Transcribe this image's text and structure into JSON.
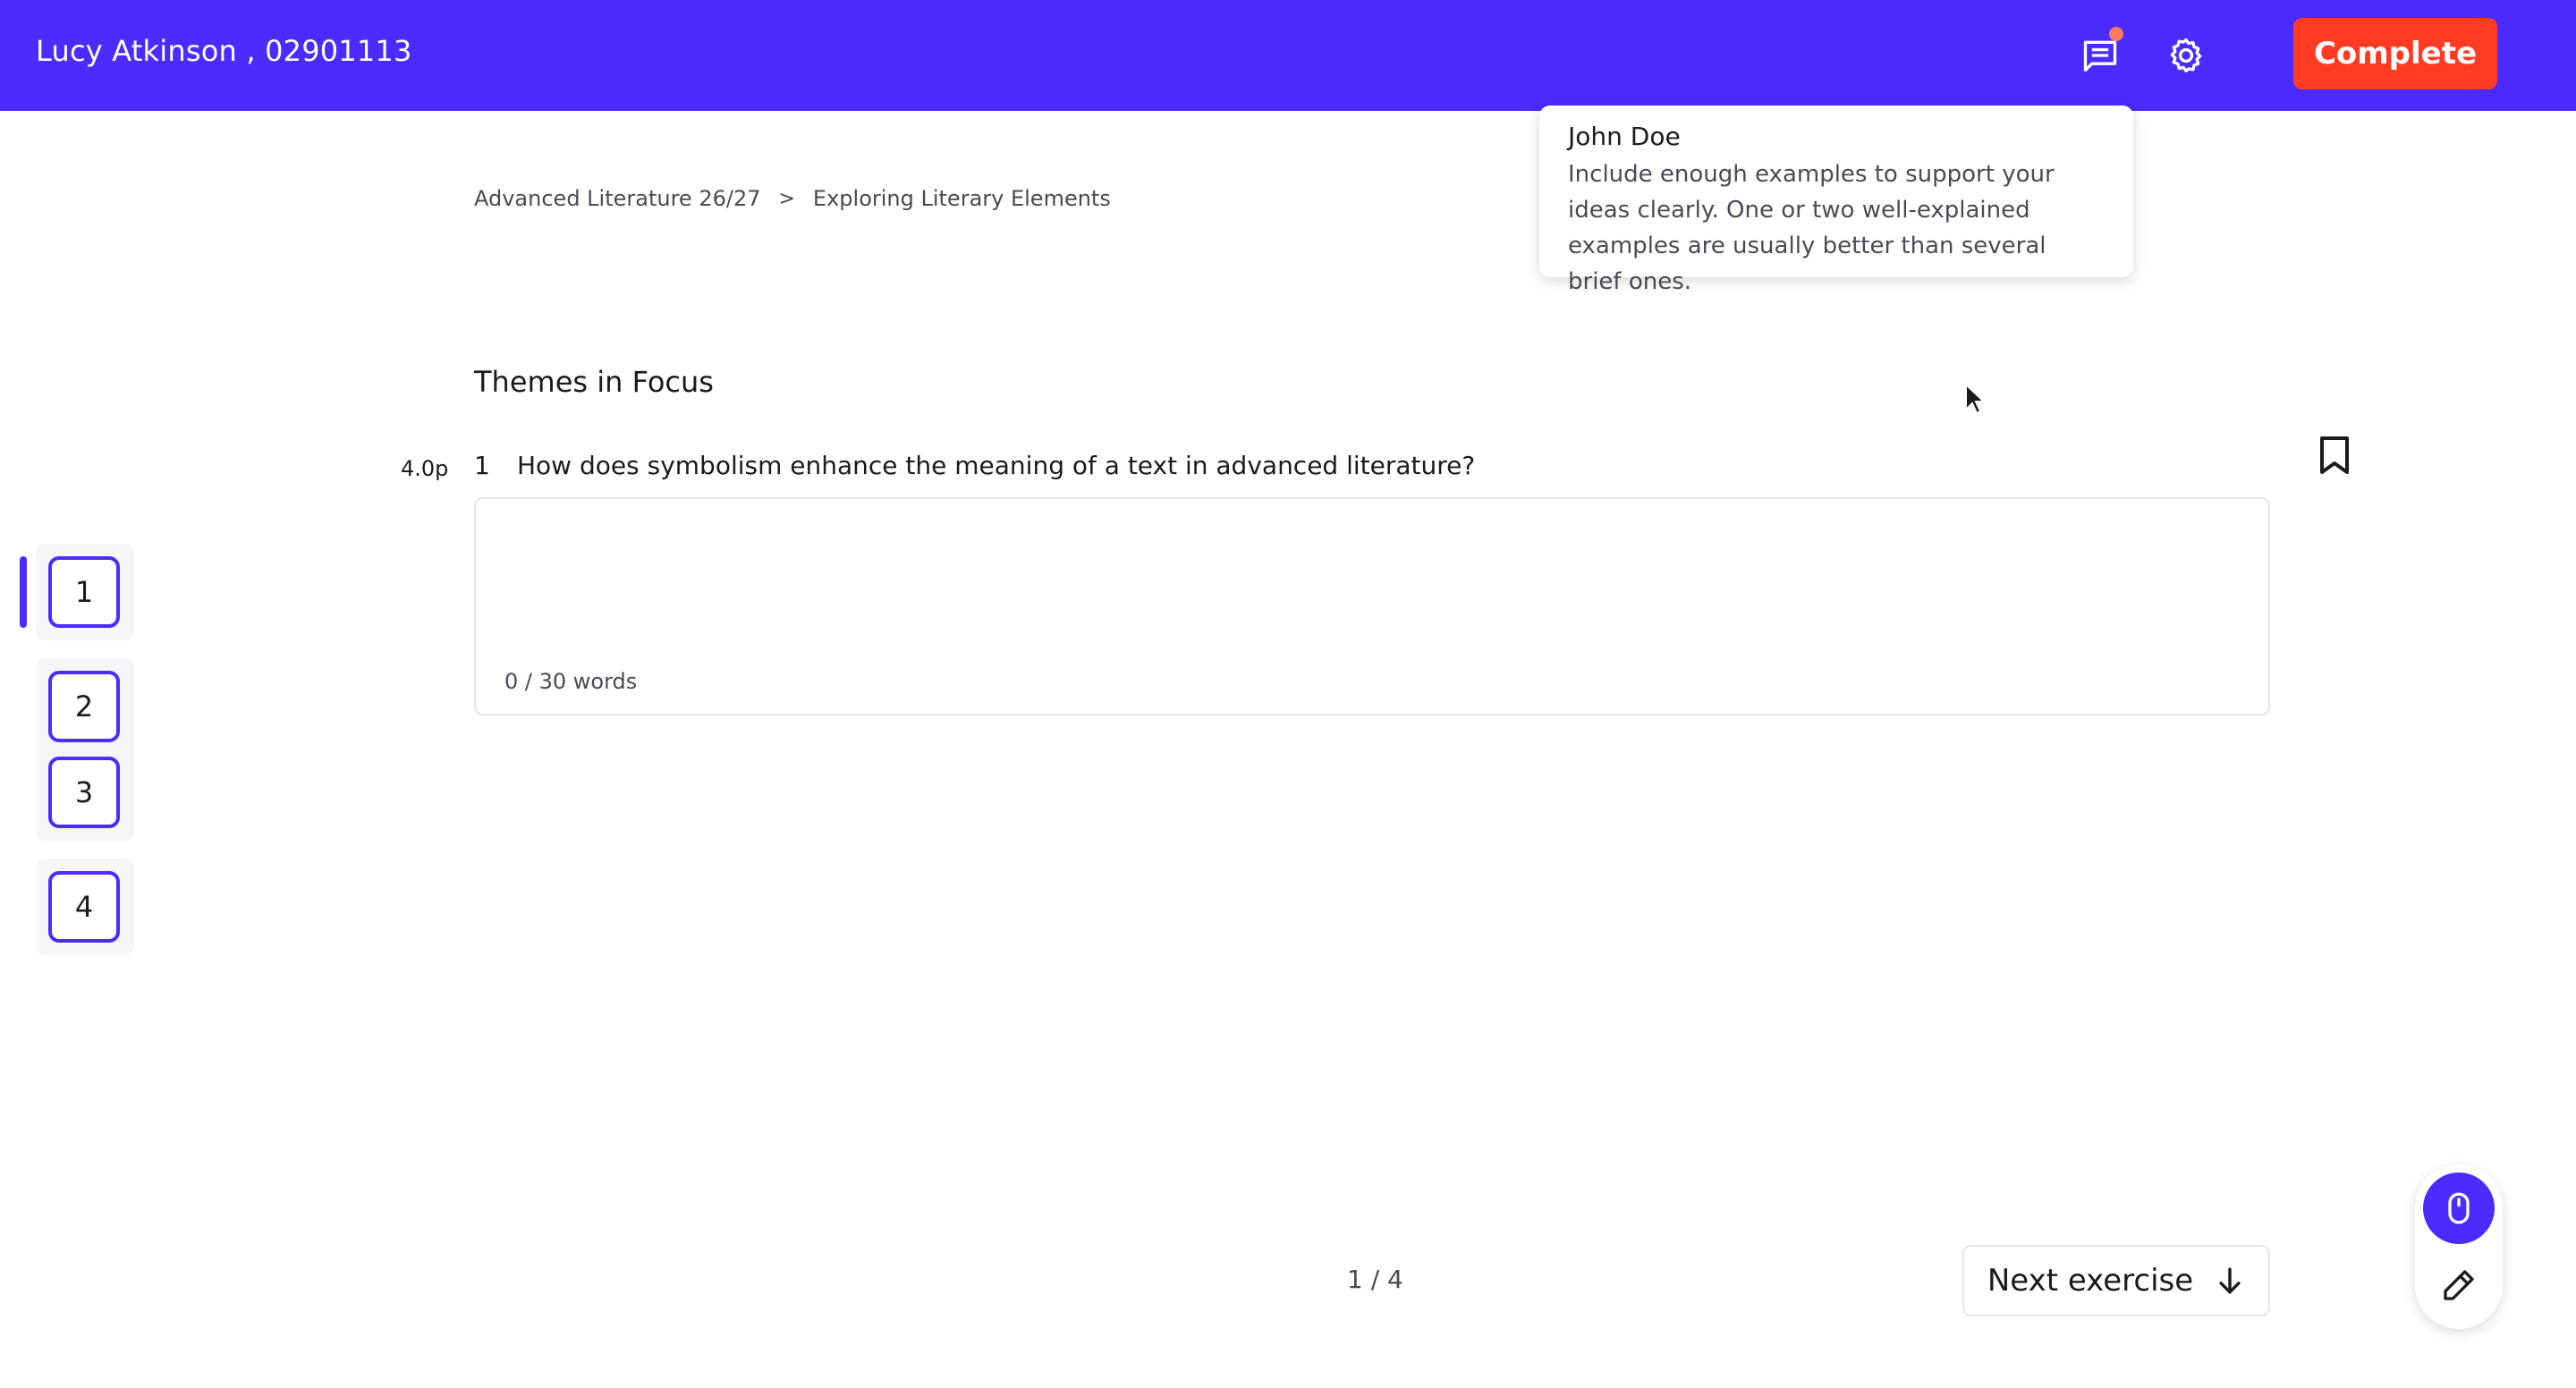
{
  "header": {
    "student": "Lucy Atkinson , 02901113",
    "complete_label": "Complete",
    "icons": [
      "chat-icon",
      "gear-icon"
    ],
    "has_notification": true
  },
  "tooltip": {
    "author": "John Doe",
    "text": "Include enough examples to support your ideas clearly. One or two well-explained examples are usually better than several brief ones."
  },
  "breadcrumb": {
    "course": "Advanced Literature 26/27",
    "separator": ">",
    "lesson": "Exploring Literary Elements"
  },
  "section": {
    "title": "Themes in Focus"
  },
  "question": {
    "points": "4.0p",
    "number": "1",
    "text": "How does symbolism enhance the meaning of a text in advanced literature?",
    "word_count": "0 / 30 words"
  },
  "navigator": {
    "items": [
      "1",
      "2",
      "3",
      "4"
    ],
    "active": "1"
  },
  "footer": {
    "pagination": "1 / 4",
    "next_label": "Next exercise"
  },
  "tools": {
    "active": "mouse-icon",
    "items": [
      "mouse-icon",
      "pen-icon"
    ]
  },
  "colors": {
    "brand": "#4c2bff",
    "accent": "#ff3b24",
    "notification": "#ff7a59"
  }
}
